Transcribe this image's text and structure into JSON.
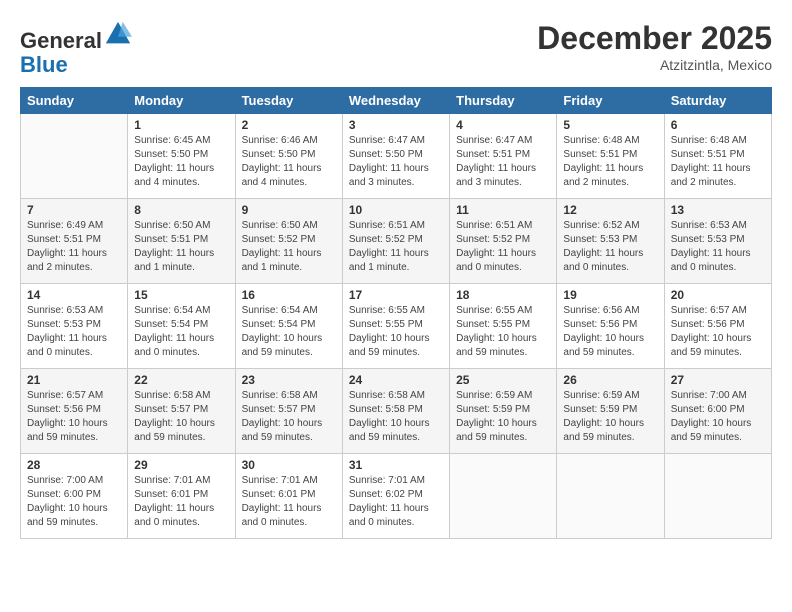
{
  "header": {
    "logo_line1": "General",
    "logo_line2": "Blue",
    "month_year": "December 2025",
    "location": "Atzitzintla, Mexico"
  },
  "days_of_week": [
    "Sunday",
    "Monday",
    "Tuesday",
    "Wednesday",
    "Thursday",
    "Friday",
    "Saturday"
  ],
  "weeks": [
    [
      {
        "day": "",
        "sunrise": "",
        "sunset": "",
        "daylight": ""
      },
      {
        "day": "1",
        "sunrise": "Sunrise: 6:45 AM",
        "sunset": "Sunset: 5:50 PM",
        "daylight": "Daylight: 11 hours and 4 minutes."
      },
      {
        "day": "2",
        "sunrise": "Sunrise: 6:46 AM",
        "sunset": "Sunset: 5:50 PM",
        "daylight": "Daylight: 11 hours and 4 minutes."
      },
      {
        "day": "3",
        "sunrise": "Sunrise: 6:47 AM",
        "sunset": "Sunset: 5:50 PM",
        "daylight": "Daylight: 11 hours and 3 minutes."
      },
      {
        "day": "4",
        "sunrise": "Sunrise: 6:47 AM",
        "sunset": "Sunset: 5:51 PM",
        "daylight": "Daylight: 11 hours and 3 minutes."
      },
      {
        "day": "5",
        "sunrise": "Sunrise: 6:48 AM",
        "sunset": "Sunset: 5:51 PM",
        "daylight": "Daylight: 11 hours and 2 minutes."
      },
      {
        "day": "6",
        "sunrise": "Sunrise: 6:48 AM",
        "sunset": "Sunset: 5:51 PM",
        "daylight": "Daylight: 11 hours and 2 minutes."
      }
    ],
    [
      {
        "day": "7",
        "sunrise": "Sunrise: 6:49 AM",
        "sunset": "Sunset: 5:51 PM",
        "daylight": "Daylight: 11 hours and 2 minutes."
      },
      {
        "day": "8",
        "sunrise": "Sunrise: 6:50 AM",
        "sunset": "Sunset: 5:51 PM",
        "daylight": "Daylight: 11 hours and 1 minute."
      },
      {
        "day": "9",
        "sunrise": "Sunrise: 6:50 AM",
        "sunset": "Sunset: 5:52 PM",
        "daylight": "Daylight: 11 hours and 1 minute."
      },
      {
        "day": "10",
        "sunrise": "Sunrise: 6:51 AM",
        "sunset": "Sunset: 5:52 PM",
        "daylight": "Daylight: 11 hours and 1 minute."
      },
      {
        "day": "11",
        "sunrise": "Sunrise: 6:51 AM",
        "sunset": "Sunset: 5:52 PM",
        "daylight": "Daylight: 11 hours and 0 minutes."
      },
      {
        "day": "12",
        "sunrise": "Sunrise: 6:52 AM",
        "sunset": "Sunset: 5:53 PM",
        "daylight": "Daylight: 11 hours and 0 minutes."
      },
      {
        "day": "13",
        "sunrise": "Sunrise: 6:53 AM",
        "sunset": "Sunset: 5:53 PM",
        "daylight": "Daylight: 11 hours and 0 minutes."
      }
    ],
    [
      {
        "day": "14",
        "sunrise": "Sunrise: 6:53 AM",
        "sunset": "Sunset: 5:53 PM",
        "daylight": "Daylight: 11 hours and 0 minutes."
      },
      {
        "day": "15",
        "sunrise": "Sunrise: 6:54 AM",
        "sunset": "Sunset: 5:54 PM",
        "daylight": "Daylight: 11 hours and 0 minutes."
      },
      {
        "day": "16",
        "sunrise": "Sunrise: 6:54 AM",
        "sunset": "Sunset: 5:54 PM",
        "daylight": "Daylight: 10 hours and 59 minutes."
      },
      {
        "day": "17",
        "sunrise": "Sunrise: 6:55 AM",
        "sunset": "Sunset: 5:55 PM",
        "daylight": "Daylight: 10 hours and 59 minutes."
      },
      {
        "day": "18",
        "sunrise": "Sunrise: 6:55 AM",
        "sunset": "Sunset: 5:55 PM",
        "daylight": "Daylight: 10 hours and 59 minutes."
      },
      {
        "day": "19",
        "sunrise": "Sunrise: 6:56 AM",
        "sunset": "Sunset: 5:56 PM",
        "daylight": "Daylight: 10 hours and 59 minutes."
      },
      {
        "day": "20",
        "sunrise": "Sunrise: 6:57 AM",
        "sunset": "Sunset: 5:56 PM",
        "daylight": "Daylight: 10 hours and 59 minutes."
      }
    ],
    [
      {
        "day": "21",
        "sunrise": "Sunrise: 6:57 AM",
        "sunset": "Sunset: 5:56 PM",
        "daylight": "Daylight: 10 hours and 59 minutes."
      },
      {
        "day": "22",
        "sunrise": "Sunrise: 6:58 AM",
        "sunset": "Sunset: 5:57 PM",
        "daylight": "Daylight: 10 hours and 59 minutes."
      },
      {
        "day": "23",
        "sunrise": "Sunrise: 6:58 AM",
        "sunset": "Sunset: 5:57 PM",
        "daylight": "Daylight: 10 hours and 59 minutes."
      },
      {
        "day": "24",
        "sunrise": "Sunrise: 6:58 AM",
        "sunset": "Sunset: 5:58 PM",
        "daylight": "Daylight: 10 hours and 59 minutes."
      },
      {
        "day": "25",
        "sunrise": "Sunrise: 6:59 AM",
        "sunset": "Sunset: 5:59 PM",
        "daylight": "Daylight: 10 hours and 59 minutes."
      },
      {
        "day": "26",
        "sunrise": "Sunrise: 6:59 AM",
        "sunset": "Sunset: 5:59 PM",
        "daylight": "Daylight: 10 hours and 59 minutes."
      },
      {
        "day": "27",
        "sunrise": "Sunrise: 7:00 AM",
        "sunset": "Sunset: 6:00 PM",
        "daylight": "Daylight: 10 hours and 59 minutes."
      }
    ],
    [
      {
        "day": "28",
        "sunrise": "Sunrise: 7:00 AM",
        "sunset": "Sunset: 6:00 PM",
        "daylight": "Daylight: 10 hours and 59 minutes."
      },
      {
        "day": "29",
        "sunrise": "Sunrise: 7:01 AM",
        "sunset": "Sunset: 6:01 PM",
        "daylight": "Daylight: 11 hours and 0 minutes."
      },
      {
        "day": "30",
        "sunrise": "Sunrise: 7:01 AM",
        "sunset": "Sunset: 6:01 PM",
        "daylight": "Daylight: 11 hours and 0 minutes."
      },
      {
        "day": "31",
        "sunrise": "Sunrise: 7:01 AM",
        "sunset": "Sunset: 6:02 PM",
        "daylight": "Daylight: 11 hours and 0 minutes."
      },
      {
        "day": "",
        "sunrise": "",
        "sunset": "",
        "daylight": ""
      },
      {
        "day": "",
        "sunrise": "",
        "sunset": "",
        "daylight": ""
      },
      {
        "day": "",
        "sunrise": "",
        "sunset": "",
        "daylight": ""
      }
    ]
  ]
}
